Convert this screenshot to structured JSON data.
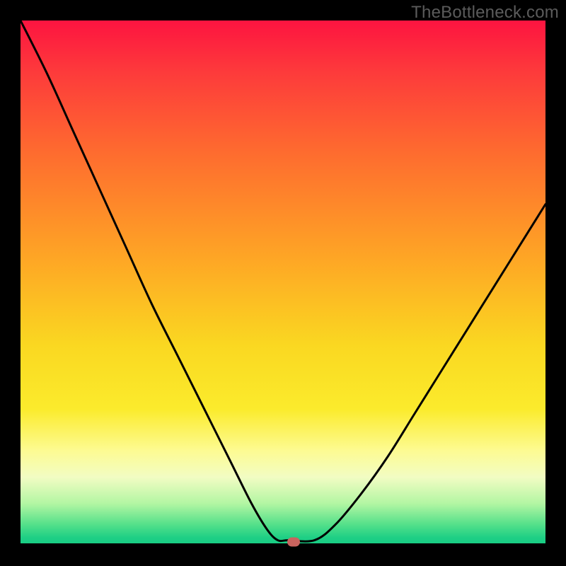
{
  "watermark": "TheBottleneck.com",
  "chart_data": {
    "type": "line",
    "title": "",
    "xlabel": "",
    "ylabel": "",
    "xlim": [
      0,
      100
    ],
    "ylim": [
      0,
      100
    ],
    "grid": false,
    "legend": false,
    "background": {
      "type": "vertical-gradient",
      "stops": [
        {
          "pct": 0,
          "color": "#fd1440"
        },
        {
          "pct": 10,
          "color": "#fd3b3b"
        },
        {
          "pct": 25,
          "color": "#fe6b2f"
        },
        {
          "pct": 45,
          "color": "#fea525"
        },
        {
          "pct": 62,
          "color": "#fad821"
        },
        {
          "pct": 74,
          "color": "#fbeb2c"
        },
        {
          "pct": 82,
          "color": "#fdfb93"
        },
        {
          "pct": 87,
          "color": "#f2fcc3"
        },
        {
          "pct": 92,
          "color": "#b3f6a3"
        },
        {
          "pct": 96,
          "color": "#54e08a"
        },
        {
          "pct": 100,
          "color": "#17cc84"
        }
      ]
    },
    "series": [
      {
        "name": "bottleneck-curve",
        "color": "#000000",
        "x": [
          0,
          5,
          10,
          15,
          20,
          25,
          30,
          35,
          40,
          44,
          47,
          49,
          51,
          56,
          60,
          65,
          70,
          75,
          80,
          85,
          90,
          95,
          100
        ],
        "y": [
          100,
          90,
          79,
          68,
          57,
          46,
          36,
          26,
          16,
          8,
          3,
          1,
          1,
          1,
          4,
          10,
          17,
          25,
          33,
          41,
          49,
          57,
          65
        ]
      },
      {
        "name": "baseline",
        "color": "#000000",
        "x": [
          0,
          100
        ],
        "y": [
          0.2,
          0.2
        ]
      }
    ],
    "marker": {
      "name": "optimal-point",
      "x": 52,
      "y": 0.7,
      "color": "#c9635e"
    }
  }
}
